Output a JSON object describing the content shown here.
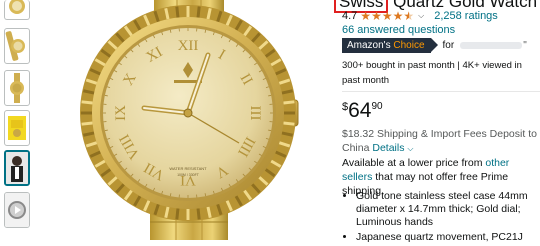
{
  "product": {
    "title_highlighted": "Swiss",
    "title_rest": " Quartz Gold Watch"
  },
  "rating": {
    "value": "4.7",
    "stars": 4.5,
    "count_label": "2,258 ratings",
    "answered_label": "66 answered questions"
  },
  "badge": {
    "prefix": "Amazon's ",
    "highlight": "Choice",
    "for_label": "for",
    "for_close": "\""
  },
  "social_proof": "300+ bought in past month | 4K+ viewed in past month",
  "price": {
    "symbol": "$",
    "whole": "64",
    "fraction": "90"
  },
  "shipping": {
    "text": "$18.32 Shipping & Import Fees Deposit to China ",
    "details_link": "Details"
  },
  "availability": {
    "prefix": "Available at a lower price from ",
    "link": "other sellers",
    "suffix": " that may not offer free Prime shipping."
  },
  "bullets": [
    "Gold tone stainless steel case 44mm diameter x 14.7mm thick; Gold dial; Luminous hands",
    "Japanese quartz movement, PC21J"
  ],
  "watch_face": {
    "dial_text_1": "WATER RESISTANT",
    "dial_text_2": "100M / 330FT"
  },
  "colors": {
    "link": "#007185",
    "star": "#de7921",
    "highlight_border": "#e02020",
    "badge_bg": "#232f3e",
    "badge_accent": "#ff9900",
    "gold": "#d4b55a"
  }
}
